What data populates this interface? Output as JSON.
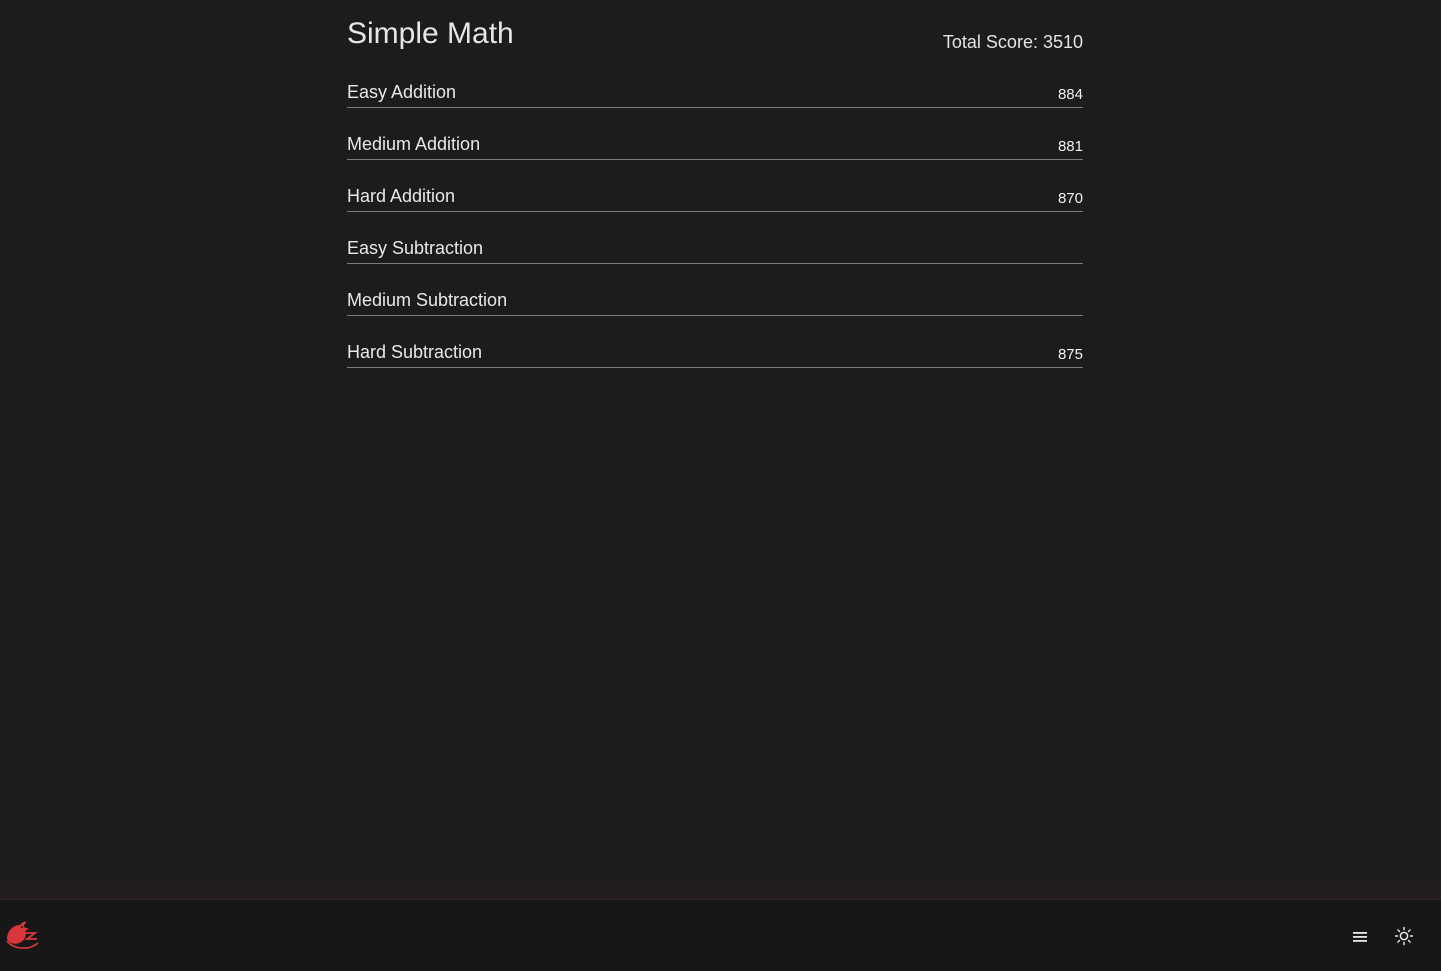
{
  "page": {
    "title": "Simple Math",
    "total_score_label": "Total Score:",
    "total_score_value": "3510"
  },
  "categories": [
    {
      "label": "Easy Addition",
      "score": "884"
    },
    {
      "label": "Medium Addition",
      "score": "881"
    },
    {
      "label": "Hard Addition",
      "score": "870"
    },
    {
      "label": "Easy Subtraction",
      "score": ""
    },
    {
      "label": "Medium Subtraction",
      "score": ""
    },
    {
      "label": "Hard Subtraction",
      "score": "875"
    }
  ],
  "footer": {
    "logo_icon": "bird-logo-icon",
    "menu_icon": "hamburger-menu-icon",
    "theme_icon": "sun-icon"
  },
  "colors": {
    "background": "#1b1c1c",
    "footer_background": "#161716",
    "accent": "#d9363e",
    "text": "#e4e4e4"
  }
}
